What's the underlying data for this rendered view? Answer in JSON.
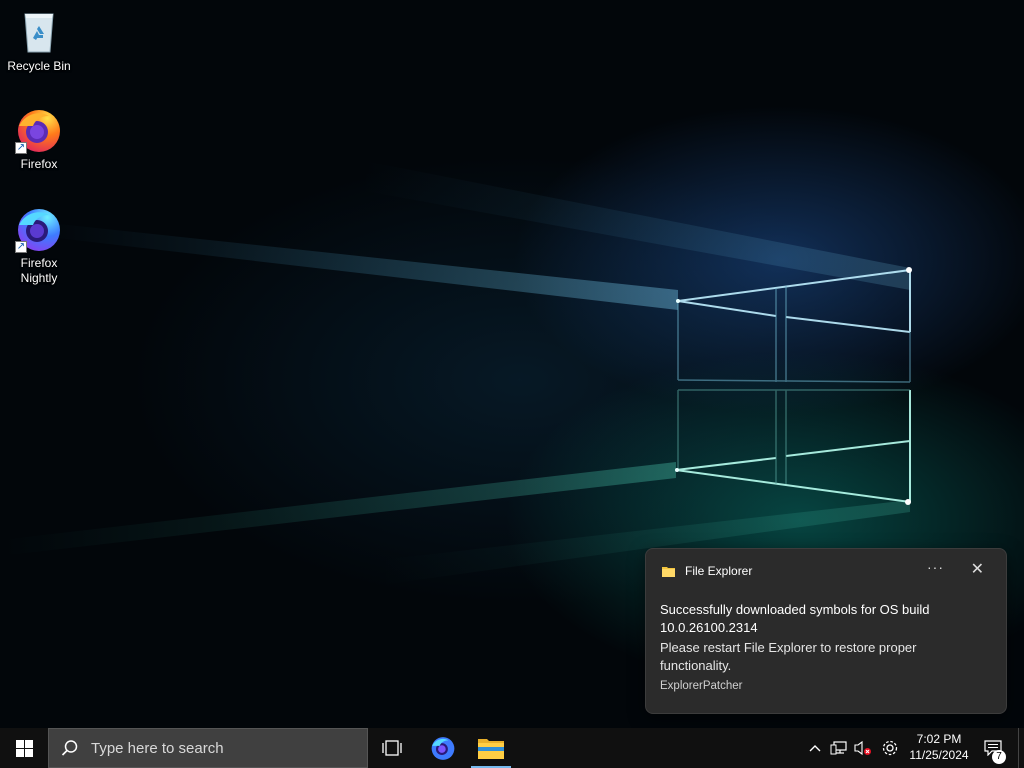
{
  "desktop": {
    "icons": [
      {
        "label": "Recycle Bin"
      },
      {
        "label": "Firefox"
      },
      {
        "label": "Firefox Nightly"
      }
    ]
  },
  "notification": {
    "app_name": "File Explorer",
    "more_glyph": "···",
    "close_glyph": "✕",
    "title": "Successfully downloaded symbols for OS build 10.0.26100.2314",
    "body": "Please restart File Explorer to restore proper functionality.",
    "attribution": "ExplorerPatcher"
  },
  "taskbar": {
    "search_placeholder": "Type here to search",
    "pinned": [
      "task-view-icon",
      "firefox-nightly-icon",
      "file-explorer-icon"
    ],
    "tray_icons": [
      "chevron-up-icon",
      "network-icon",
      "volume-muted-icon",
      "settings-icon"
    ],
    "clock_time": "7:02 PM",
    "clock_date": "11/25/2024",
    "notification_count": "7"
  },
  "colors": {
    "taskbar": "#101010",
    "search_box": "#404040",
    "toast_bg": "#2b2b2b",
    "accent": "#76b9ed"
  }
}
